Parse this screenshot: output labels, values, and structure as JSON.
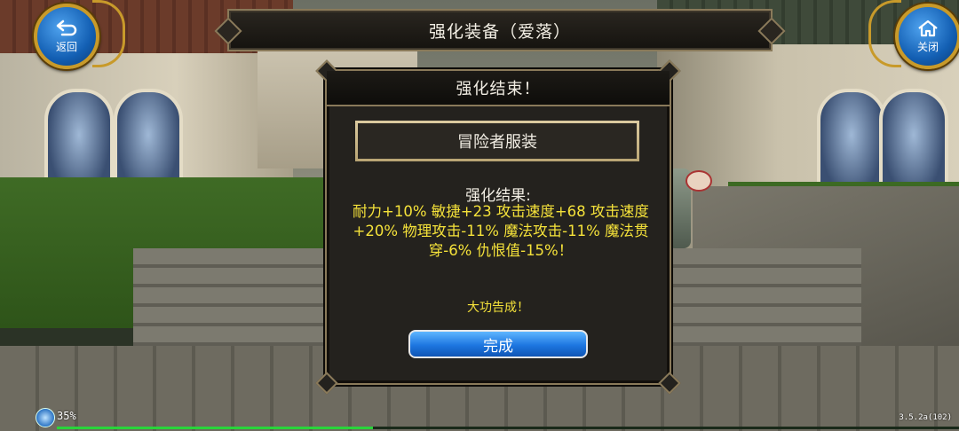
{
  "title_bar": {
    "title": "强化装备（爱落）"
  },
  "back_button": {
    "label": "返回",
    "icon": "back-arrow-icon"
  },
  "close_button": {
    "label": "关闭",
    "icon": "home-icon"
  },
  "dialog": {
    "header": "强化结束！",
    "item_name": "冒险者服装",
    "result_label": "强化结果:",
    "result_text": "耐力+10% 敏捷+23 攻击速度+68 攻击速度+20% 物理攻击-11% 魔法攻击-11% 魔法贯穿-6% 仇恨值-15%！",
    "success_message": "大功告成！",
    "done_button": "完成"
  },
  "status": {
    "battery": "35%",
    "version": "3.5.2a(102)",
    "exp_progress": 0.35
  },
  "colors": {
    "highlight_text": "#f5e23a",
    "button_blue": "#1d76e0",
    "frame_gold": "#8a7a5a",
    "exp_green": "#29d43a"
  }
}
